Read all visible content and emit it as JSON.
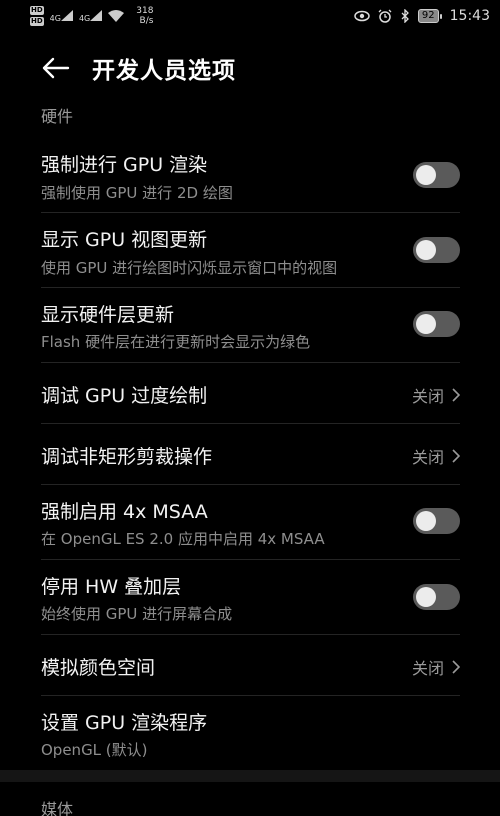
{
  "status_bar": {
    "sim1": "HD",
    "sim2": "HD",
    "signal1": "4G",
    "signal2": "4G",
    "speed_value": "318",
    "speed_unit": "B/s",
    "battery": "92",
    "time": "15:43"
  },
  "header": {
    "title": "开发人员选项"
  },
  "sections": {
    "hardware": "硬件",
    "media": "媒体"
  },
  "rows": {
    "gpu_render": {
      "title": "强制进行 GPU 渲染",
      "subtitle": "强制使用 GPU 进行 2D 绘图",
      "enabled": false
    },
    "gpu_view_updates": {
      "title": "显示 GPU 视图更新",
      "subtitle": "使用 GPU 进行绘图时闪烁显示窗口中的视图",
      "enabled": false
    },
    "hw_layer_updates": {
      "title": "显示硬件层更新",
      "subtitle": "Flash 硬件层在进行更新时会显示为绿色",
      "enabled": false
    },
    "gpu_overdraw": {
      "title": "调试 GPU 过度绘制",
      "value": "关闭"
    },
    "non_rect_clip": {
      "title": "调试非矩形剪裁操作",
      "value": "关闭"
    },
    "msaa": {
      "title": "强制启用 4x MSAA",
      "subtitle": "在 OpenGL ES 2.0 应用中启用 4x MSAA",
      "enabled": false
    },
    "disable_hw_overlay": {
      "title": "停用 HW 叠加层",
      "subtitle": "始终使用 GPU 进行屏幕合成",
      "enabled": false
    },
    "color_space": {
      "title": "模拟颜色空间",
      "value": "关闭"
    },
    "gpu_renderer": {
      "title": "设置 GPU 渲染程序",
      "subtitle": "OpenGL (默认)"
    }
  }
}
